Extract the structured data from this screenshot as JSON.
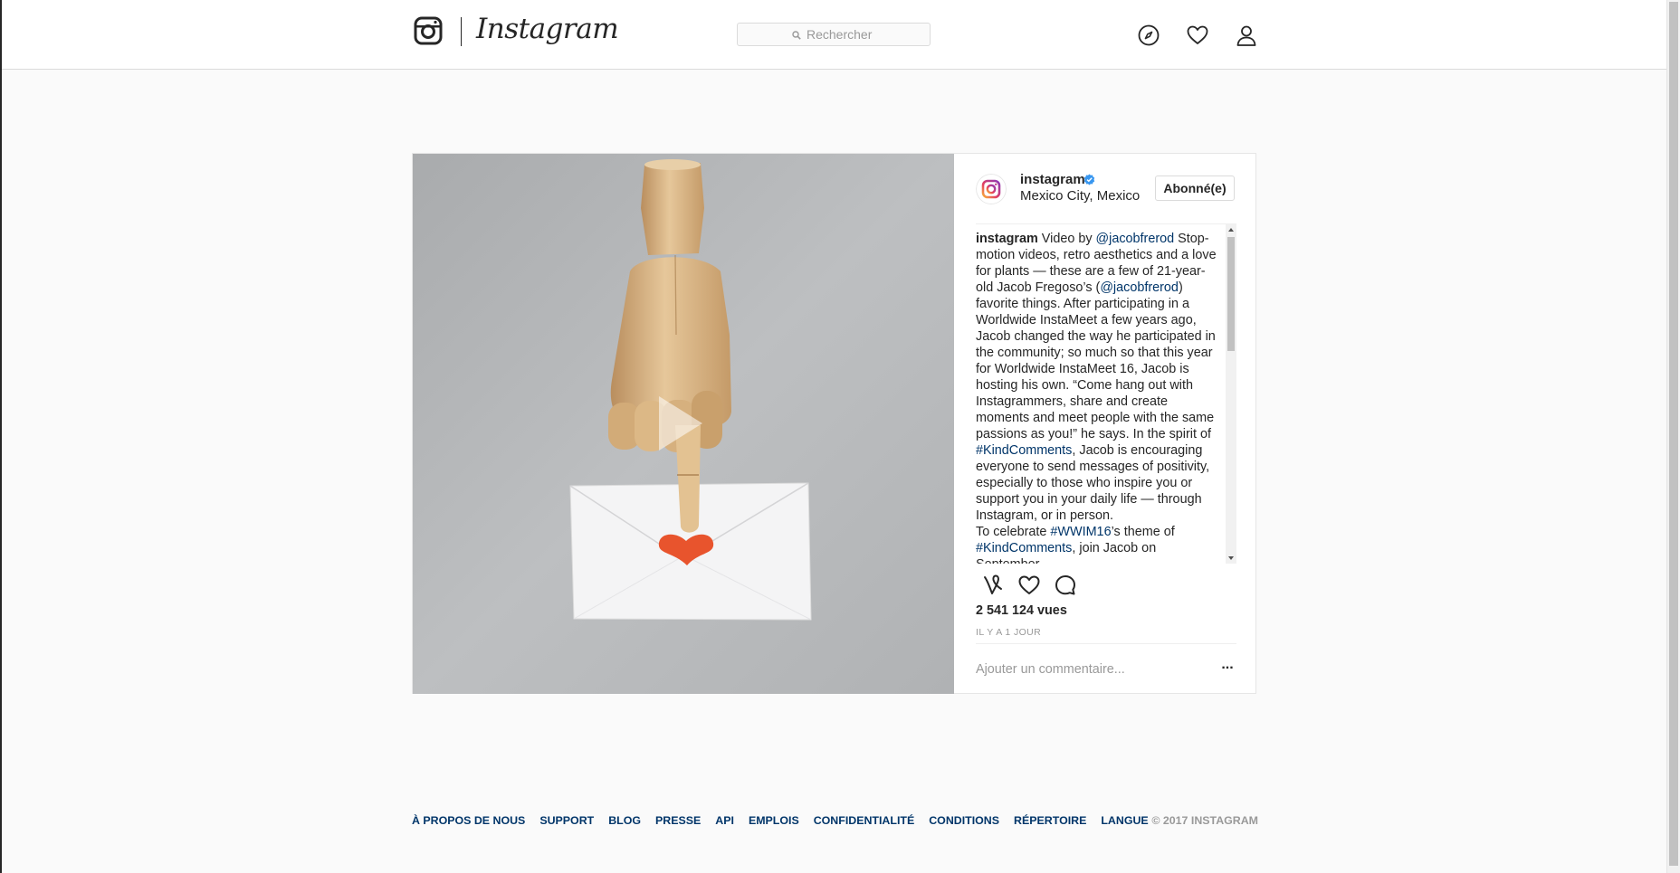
{
  "header": {
    "wordmark": "Instagram",
    "search_placeholder": "Rechercher"
  },
  "post": {
    "username": "instagram",
    "location": "Mexico City, Mexico",
    "follow_label": "Abonné(e)",
    "caption": {
      "username": "instagram",
      "t1": " Video by ",
      "mention1": "@jacobfrerod",
      "t2": " Stop-motion videos, retro aesthetics and a love for plants — these are a few of 21-year-old Jacob Fregoso’s (",
      "mention2": "@jacobfrerod",
      "t3": ") favorite things. After participating in a Worldwide InstaMeet a few years ago, Jacob changed the way he participated in the community; so much so that this year for Worldwide InstaMeet 16, Jacob is hosting his own. “Come hang out with Instagrammers, share and create moments and meet people with the same passions as you!” he says. In the spirit of ",
      "hashtag1": "#KindComments",
      "t4": ", Jacob is encouraging everyone to send messages of positivity, especially to those who inspire you or support you in your daily life — through Instagram, or in person.",
      "t5": "To celebrate ",
      "hashtag2": "#WWIM16",
      "t6": "’s theme of ",
      "hashtag3": "#KindComments",
      "t7": ", join Jacob on September"
    },
    "views": "2 541 124 vues",
    "timestamp": "IL Y A 1 JOUR",
    "comment_placeholder": "Ajouter un commentaire...",
    "more_label": "..."
  },
  "footer": {
    "links": [
      "À PROPOS DE NOUS",
      "SUPPORT",
      "BLOG",
      "PRESSE",
      "API",
      "EMPLOIS",
      "CONFIDENTIALITÉ",
      "CONDITIONS",
      "RÉPERTOIRE",
      "LANGUE"
    ],
    "copyright": "© 2017 INSTAGRAM"
  },
  "colors": {
    "link": "#003569",
    "verified": "#3897f0",
    "muted": "#999999",
    "border": "#dbdbdb"
  }
}
